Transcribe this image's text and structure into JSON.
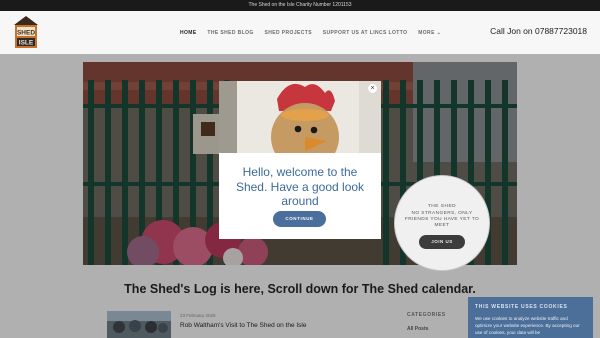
{
  "topbar": {
    "text": "The Shed on the Isle Charity Number 1201153"
  },
  "header": {
    "logo": {
      "line1": "SHED",
      "line2": "ISLE"
    },
    "nav": [
      {
        "label": "HOME",
        "active": true
      },
      {
        "label": "THE SHED BLOG",
        "active": false
      },
      {
        "label": "SHED PROJECTS",
        "active": false
      },
      {
        "label": "SUPPORT US AT LINCS LOTTO",
        "active": false
      },
      {
        "label": "MORE",
        "active": false
      }
    ],
    "call": "Call Jon on 07887723018"
  },
  "modal": {
    "title": "Hello, welcome to the Shed. Have a good look around",
    "button": "CONTINUE",
    "close": "×"
  },
  "circle": {
    "title": "THE SHED",
    "text": "NO STRANGERS, ONLY FRIENDS YOU HAVE YET TO MEET",
    "button": "JOIN US"
  },
  "main": {
    "heading": "The Shed's Log is here, Scroll down for The Shed calendar.",
    "post": {
      "date": "23 February 2025",
      "title": "Rob Waltham's Visit to The Shed on the Isle"
    },
    "categories": {
      "title": "CATEGORIES",
      "items": [
        "All Posts"
      ]
    }
  },
  "cookie": {
    "title": "THIS WEBSITE USES COOKIES",
    "text": "We use cookies to analyze website traffic and optimize your website experience. By accepting our use of cookies, your data will be"
  }
}
